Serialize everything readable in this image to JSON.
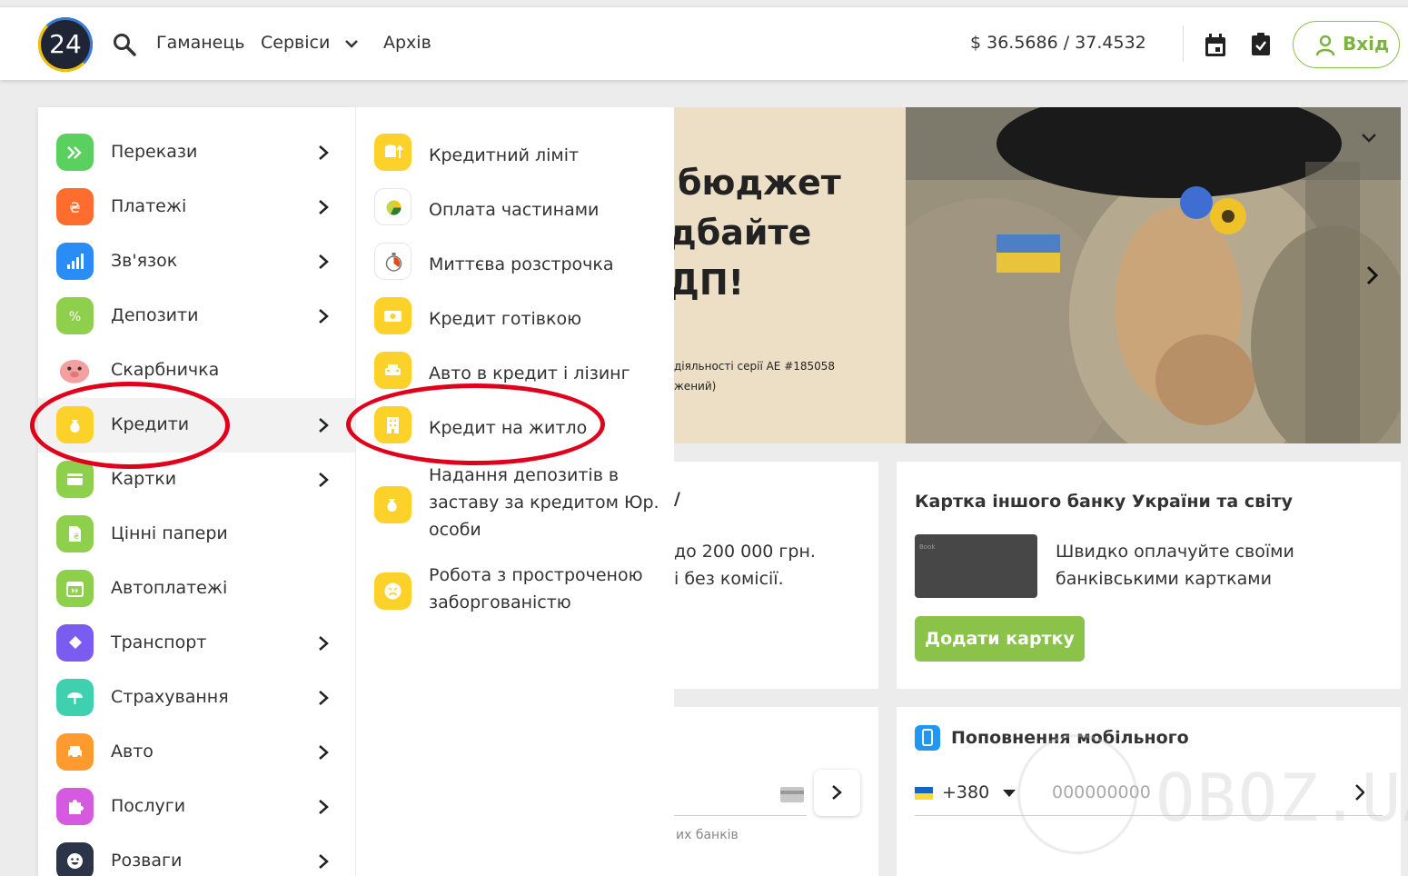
{
  "header": {
    "logo_text": "24",
    "nav": [
      "Гаманець",
      "Сервіси",
      "Архів"
    ],
    "currency": "$  36.5686 / 37.4532",
    "login_label": "Вхід"
  },
  "menu": {
    "items": [
      {
        "label": "Перекази",
        "icon": "double-chevron-icon",
        "color": "#5ad15e",
        "arrow": true
      },
      {
        "label": "Платежі",
        "icon": "hryvnia-icon",
        "color": "#ff6d2e",
        "arrow": true
      },
      {
        "label": "Зв'язок",
        "icon": "signal-bars-icon",
        "color": "#2a8df5",
        "arrow": true
      },
      {
        "label": "Депозити",
        "icon": "percent-icon",
        "color": "#8ed04b",
        "arrow": true
      },
      {
        "label": "Скарбничка",
        "icon": "piggy-icon",
        "color": "#f08a8a",
        "arrow": false
      },
      {
        "label": "Кредити",
        "icon": "money-bag-icon",
        "color": "#fcd22a",
        "arrow": true
      },
      {
        "label": "Картки",
        "icon": "card-icon",
        "color": "#8ed04b",
        "arrow": true
      },
      {
        "label": "Цінні папери",
        "icon": "document-icon",
        "color": "#8ed04b",
        "arrow": false
      },
      {
        "label": "Автоплатежі",
        "icon": "calendar-icon",
        "color": "#8ed04b",
        "arrow": false
      },
      {
        "label": "Транспорт",
        "icon": "ticket-icon",
        "color": "#7a5cf0",
        "arrow": true
      },
      {
        "label": "Страхування",
        "icon": "umbrella-icon",
        "color": "#3fd0b0",
        "arrow": true
      },
      {
        "label": "Авто",
        "icon": "car-icon",
        "color": "#ff9b2e",
        "arrow": true
      },
      {
        "label": "Послуги",
        "icon": "puzzle-icon",
        "color": "#d65ae0",
        "arrow": true
      },
      {
        "label": "Розваги",
        "icon": "smile-icon",
        "color": "#2b3449",
        "arrow": true
      }
    ]
  },
  "submenu": {
    "items": [
      {
        "label": "Кредитний ліміт",
        "icon": "coins-up-icon",
        "color": "#fcd22a"
      },
      {
        "label": "Оплата частинами",
        "icon": "pie-icon",
        "color": "#ffffff"
      },
      {
        "label": "Миттєва розстрочка",
        "icon": "stopwatch-icon",
        "color": "#ffffff"
      },
      {
        "label": "Кредит готівкою",
        "icon": "banknote-icon",
        "color": "#fcd22a"
      },
      {
        "label": "Авто в кредит і лізинг",
        "icon": "car-front-icon",
        "color": "#fcd22a"
      },
      {
        "label": "Кредит на житло",
        "icon": "building-icon",
        "color": "#fcd22a"
      },
      {
        "label": "Надання депозитів в заставу за кредитом Юр. особи",
        "icon": "money-bag-icon",
        "color": "#fcd22a"
      },
      {
        "label": "Робота з простроченою заборгованістю",
        "icon": "sad-face-icon",
        "color": "#fcd22a"
      }
    ]
  },
  "banner": {
    "headline_lines": [
      "бюджет",
      "дбайте",
      "ДП!"
    ],
    "small_lines": [
      "діяльності серії АЕ #185058",
      "жений)"
    ]
  },
  "cards": {
    "left_top_lines": [
      "до 200 000 грн.",
      "і без комісії."
    ],
    "left_top_fragment": "/",
    "other_bank": {
      "title": "Картка іншого банку України та світу",
      "card_label": "Book",
      "desc_lines": [
        "Швидко оплачуйте своїми",
        "банківськими картками"
      ],
      "button": "Додати картку"
    },
    "left_bottom_caption": "их банків",
    "mobile": {
      "title": "Поповнення мобільного",
      "prefix": "+380",
      "placeholder": "000000000"
    }
  },
  "watermark": "OBOZ.UA",
  "colors": {
    "accent_green": "#8bc34a",
    "annotation_red": "#e0001b"
  }
}
